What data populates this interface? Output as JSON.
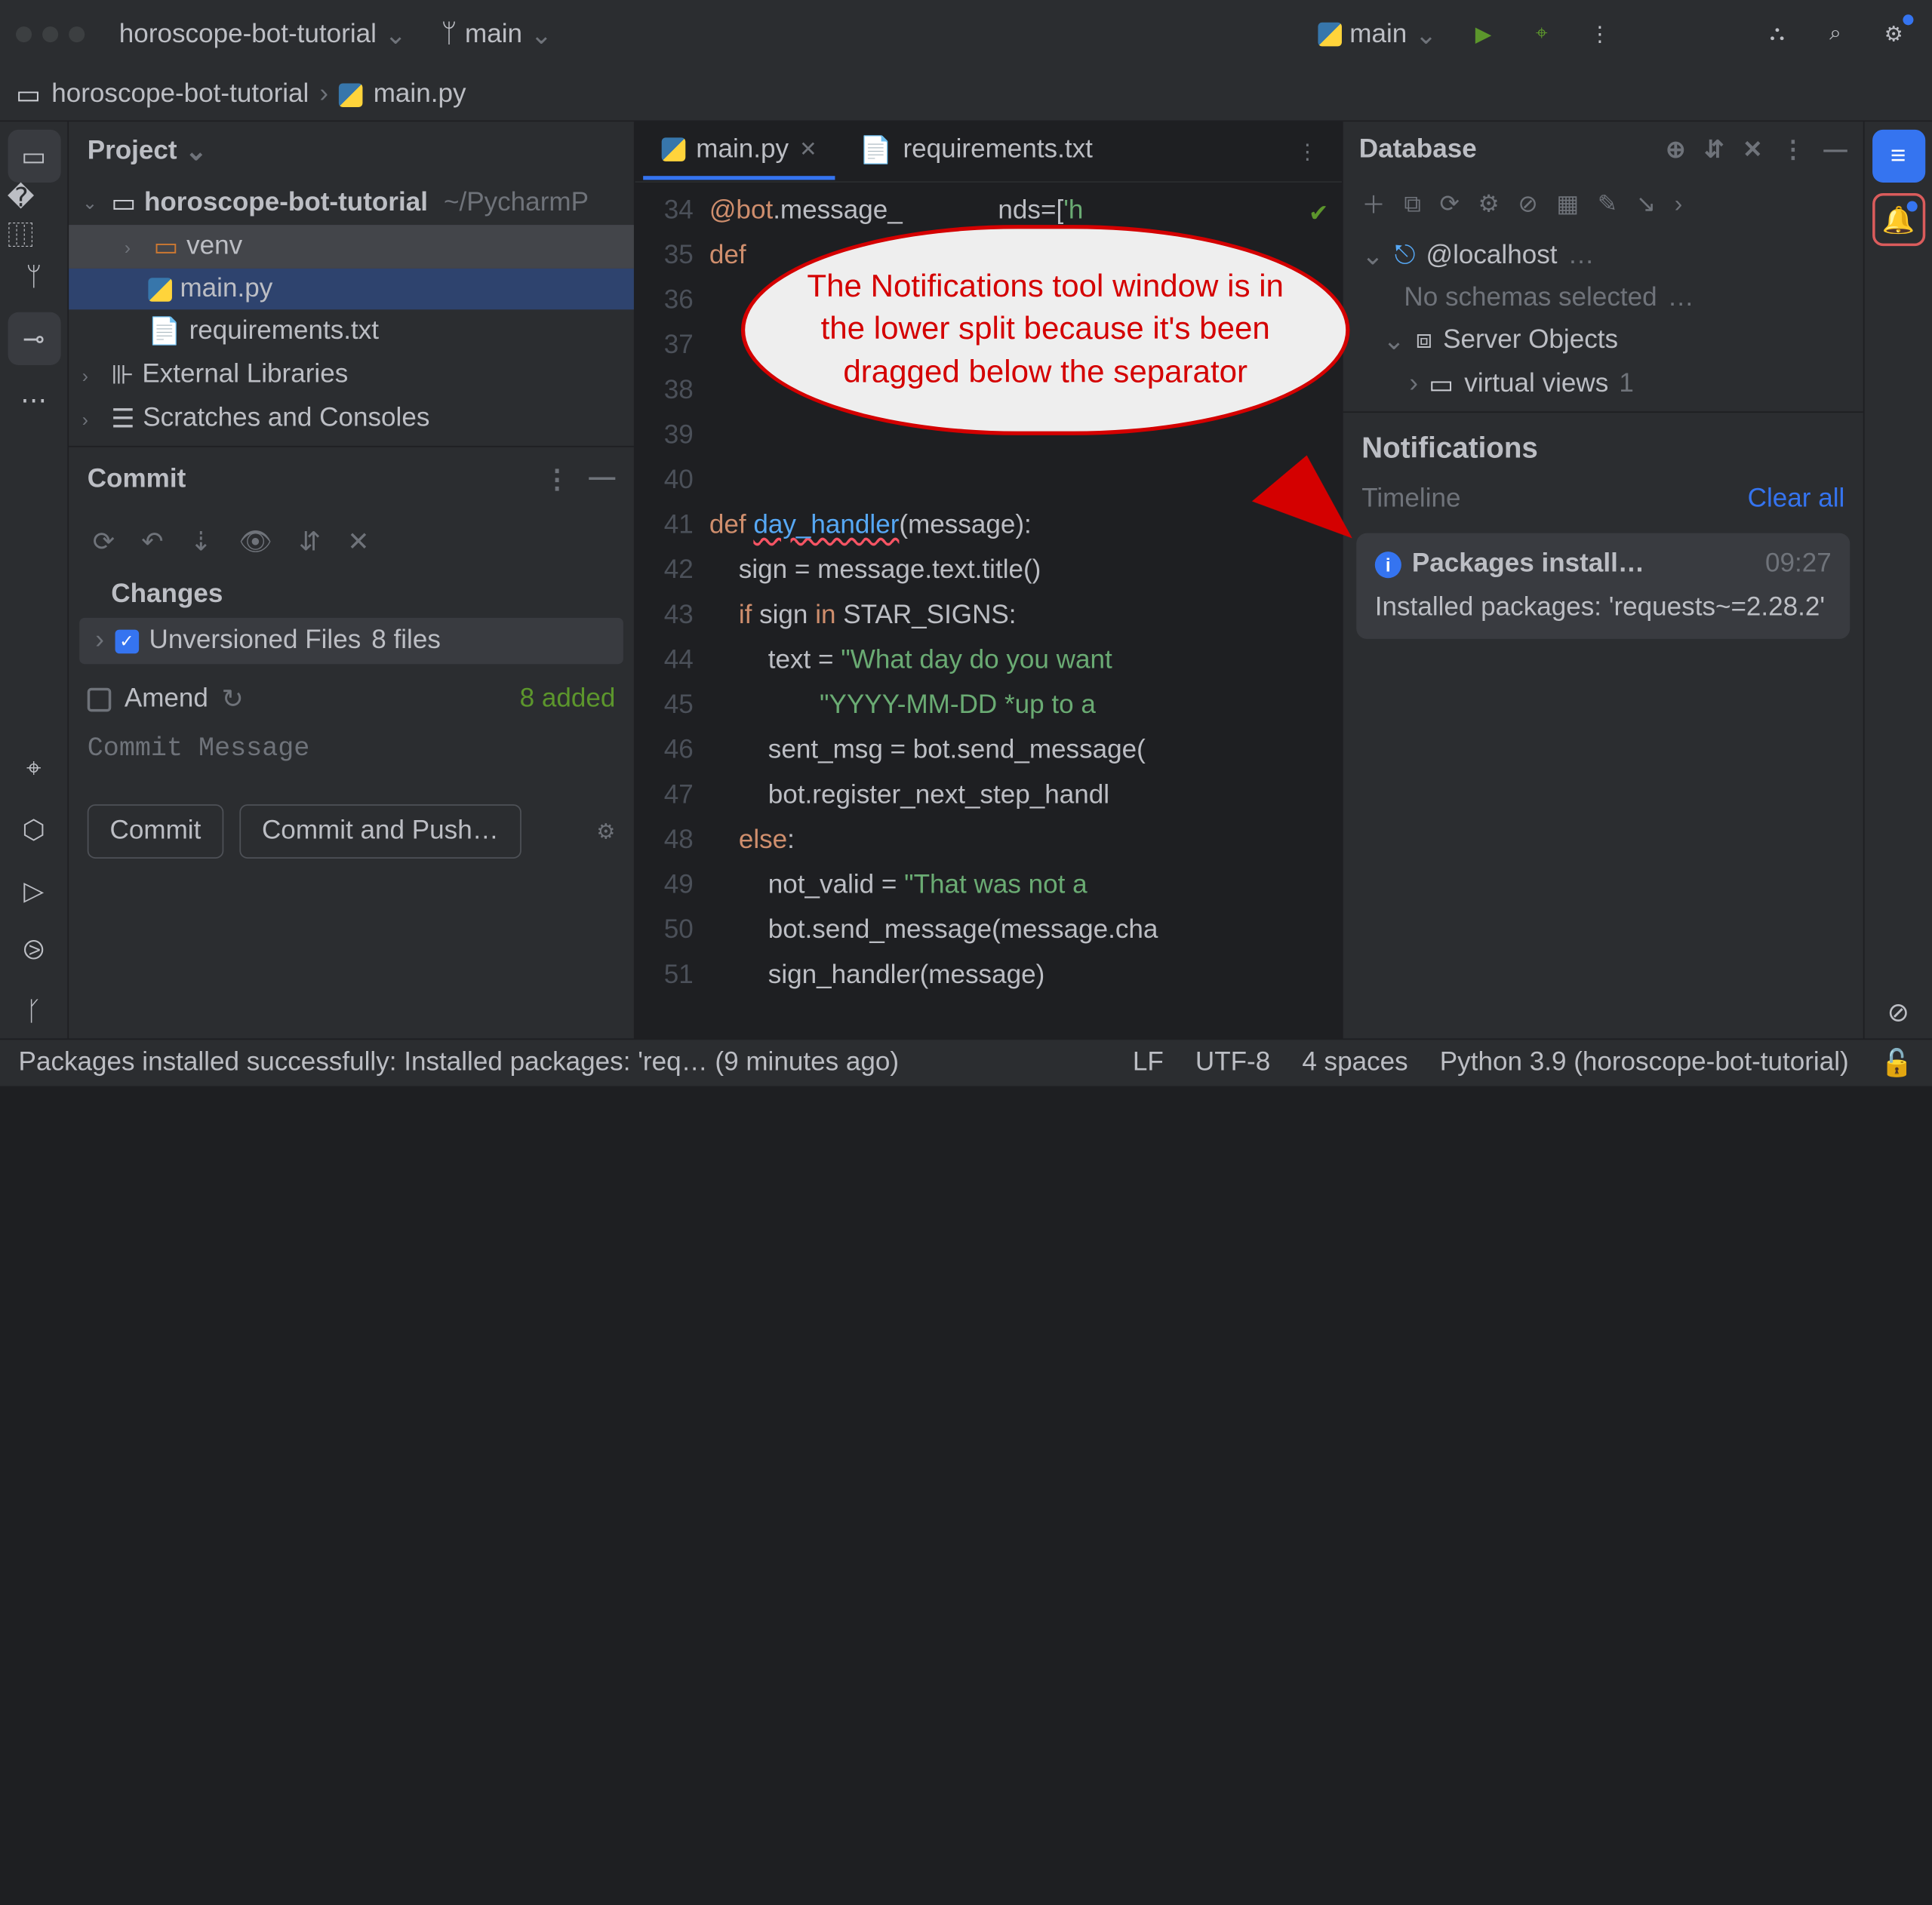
{
  "top": {
    "project": "horoscope-bot-tutorial",
    "branch": "main",
    "run_config": "main"
  },
  "breadcrumb": {
    "root": "horoscope-bot-tutorial",
    "file": "main.py"
  },
  "project_panel": {
    "title": "Project",
    "root": "horoscope-bot-tutorial",
    "root_path": "~/PycharmP",
    "venv": "venv",
    "main": "main.py",
    "req": "requirements.txt",
    "ext": "External Libraries",
    "scratch": "Scratches and Consoles"
  },
  "commit": {
    "title": "Commit",
    "changes": "Changes",
    "unversioned": "Unversioned Files",
    "unversioned_count": "8 files",
    "amend": "Amend",
    "added": "8 added",
    "placeholder": "Commit Message",
    "btn_commit": "Commit",
    "btn_push": "Commit and Push…"
  },
  "tabs": {
    "main": "main.py",
    "req": "requirements.txt"
  },
  "code": {
    "lines": [
      {
        "n": 34,
        "html": "<span class='kw'>@bot</span>.message_             <span class='id'>nds</span>=[<span class='str'>'h</span>"
      },
      {
        "n": 35,
        "html": "<span class='kw'>def</span>"
      },
      {
        "n": 36,
        "html": ""
      },
      {
        "n": 37,
        "html": "",
        "bp": true
      },
      {
        "n": 38,
        "html": "                                            <span class='id'>(s</span>"
      },
      {
        "n": 39,
        "html": ""
      },
      {
        "n": 40,
        "html": ""
      },
      {
        "n": 41,
        "html": "<span class='kw'>def</span> <span class='fn red-squig'>day_handler</span>(message):"
      },
      {
        "n": 42,
        "html": "    sign = message.text.title()"
      },
      {
        "n": 43,
        "html": "    <span class='kw'>if</span> sign <span class='kw'>in</span> STAR_SIGNS:"
      },
      {
        "n": 44,
        "html": "        text = <span class='str'>\"What day do you want</span>"
      },
      {
        "n": 45,
        "html": "               <span class='str'>\"YYYY-MM-DD *up to a </span>"
      },
      {
        "n": 46,
        "html": "        sent_msg = bot.send_message("
      },
      {
        "n": 47,
        "html": "        bot.register_next_step_handl"
      },
      {
        "n": 48,
        "html": "    <span class='kw'>else</span>:"
      },
      {
        "n": 49,
        "html": "        not_valid = <span class='str'>\"That was not a </span>"
      },
      {
        "n": 50,
        "html": "        bot.send_message(message.cha"
      },
      {
        "n": 51,
        "html": "        sign_handler(message)"
      }
    ]
  },
  "database": {
    "title": "Database",
    "host": "@localhost",
    "no_schemas": "No schemas selected",
    "server_obj": "Server Objects",
    "virtual": "virtual views",
    "virtual_count": "1"
  },
  "notifications": {
    "title": "Notifications",
    "timeline": "Timeline",
    "clear": "Clear all",
    "item_title": "Packages install…",
    "item_time": "09:27",
    "item_body": "Installed packages: 'requests~=2.28.2'"
  },
  "callout": "The Notifications tool window is in the lower split because it's been dragged below the separator",
  "status": {
    "msg": "Packages installed successfully: Installed packages: 'req… (9 minutes ago)",
    "lf": "LF",
    "enc": "UTF-8",
    "indent": "4 spaces",
    "interp": "Python 3.9 (horoscope-bot-tutorial)"
  }
}
